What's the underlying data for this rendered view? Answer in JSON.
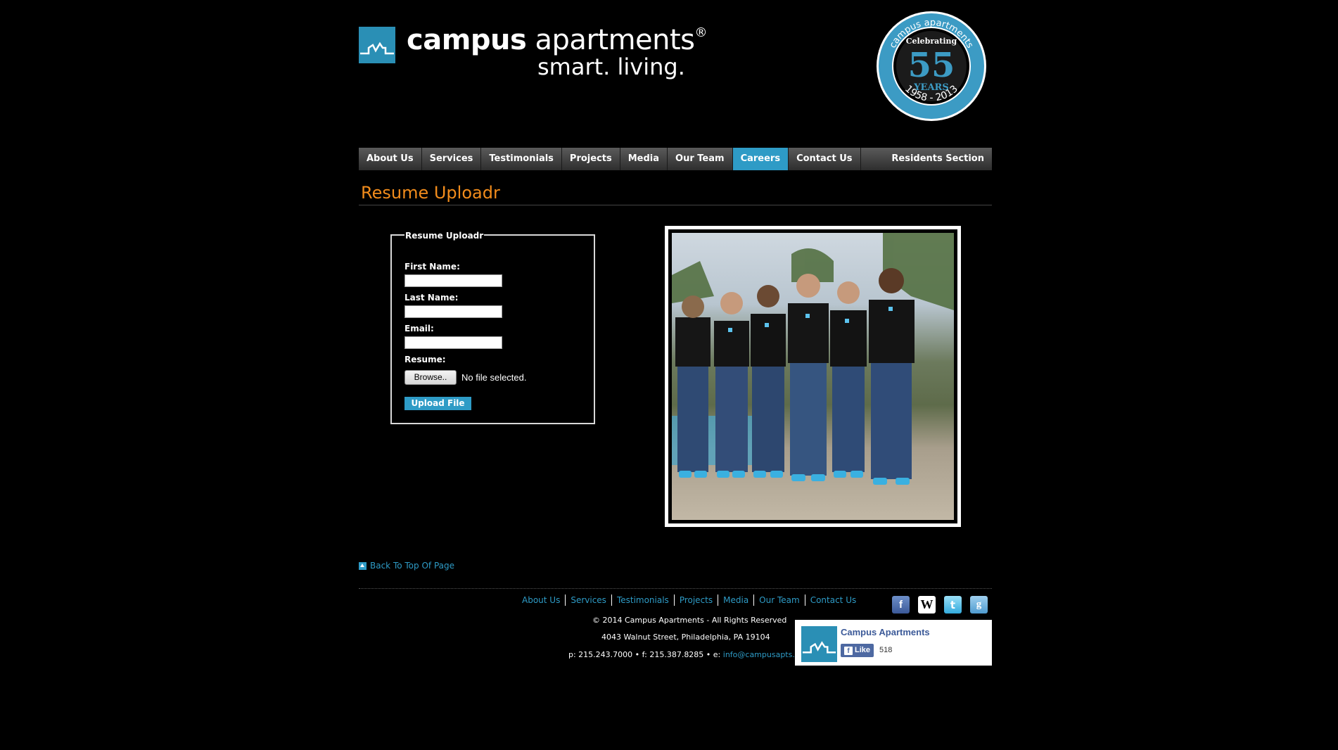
{
  "brand": {
    "name_bold": "campus",
    "name_light": "apartments",
    "registered": "®",
    "tagline": "smart. living.",
    "accent_color": "#2e9bc6",
    "title_color": "#f28c1c"
  },
  "anniversary": {
    "arc_text": "campus apartments",
    "celebrating": "Celebrating",
    "years_number": "55",
    "years_label": "YEARS",
    "range": "1958 - 2013"
  },
  "nav": {
    "items": [
      {
        "label": "About Us"
      },
      {
        "label": "Services"
      },
      {
        "label": "Testimonials"
      },
      {
        "label": "Projects"
      },
      {
        "label": "Media"
      },
      {
        "label": "Our Team"
      },
      {
        "label": "Careers"
      },
      {
        "label": "Contact Us"
      }
    ],
    "active": "Careers",
    "residents": "Residents Section"
  },
  "page": {
    "title": "Resume Uploadr"
  },
  "form": {
    "legend": "Resume Uploadr",
    "first_name_label": "First Name:",
    "first_name_value": "",
    "last_name_label": "Last Name:",
    "last_name_value": "",
    "email_label": "Email:",
    "email_value": "",
    "resume_label": "Resume:",
    "browse_label": "Browse..",
    "no_file": "No file selected.",
    "upload_label": "Upload File"
  },
  "back_to_top": "Back To Top Of Page",
  "footer": {
    "links": [
      "About Us",
      "Services",
      "Testimonials",
      "Projects",
      "Media",
      "Our Team",
      "Contact Us"
    ],
    "copyright": "© 2014 Campus Apartments - All Rights Reserved",
    "address": "4043 Walnut Street, Philadelphia, PA 19104",
    "contact_prefix": "p: 215.243.7000 • f: 215.387.8285 • e: ",
    "email": "info@campusapts.com"
  },
  "social": [
    {
      "icon": "facebook-icon",
      "glyph": "f"
    },
    {
      "icon": "wikipedia-icon",
      "glyph": "W"
    },
    {
      "icon": "twitter-icon",
      "glyph": "t"
    },
    {
      "icon": "google-icon",
      "glyph": "g"
    }
  ],
  "facebook_box": {
    "page_name": "Campus Apartments",
    "like_label": "Like",
    "like_count": "518"
  }
}
